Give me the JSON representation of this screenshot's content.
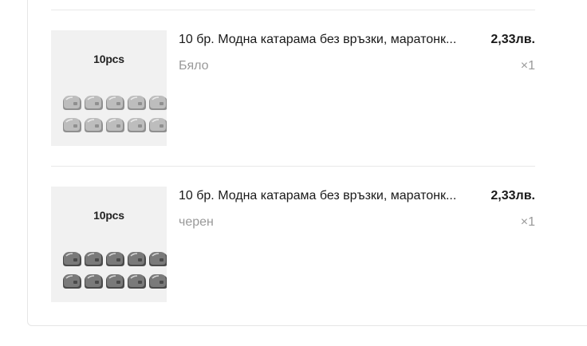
{
  "items": [
    {
      "thumb_label": "10pcs",
      "title": "10 бр. Модна катарама без връзки, маратонк...",
      "price": "2,33лв.",
      "variant": "Бяло",
      "quantity": "×1",
      "buckle_color": "#bdbdbd",
      "buckle_shade": "#8f8f8f"
    },
    {
      "thumb_label": "10pcs",
      "title": "10 бр. Модна катарама без връзки, маратонк...",
      "price": "2,33лв.",
      "variant": "черен",
      "quantity": "×1",
      "buckle_color": "#7a7a7a",
      "buckle_shade": "#4a4a4a"
    }
  ]
}
